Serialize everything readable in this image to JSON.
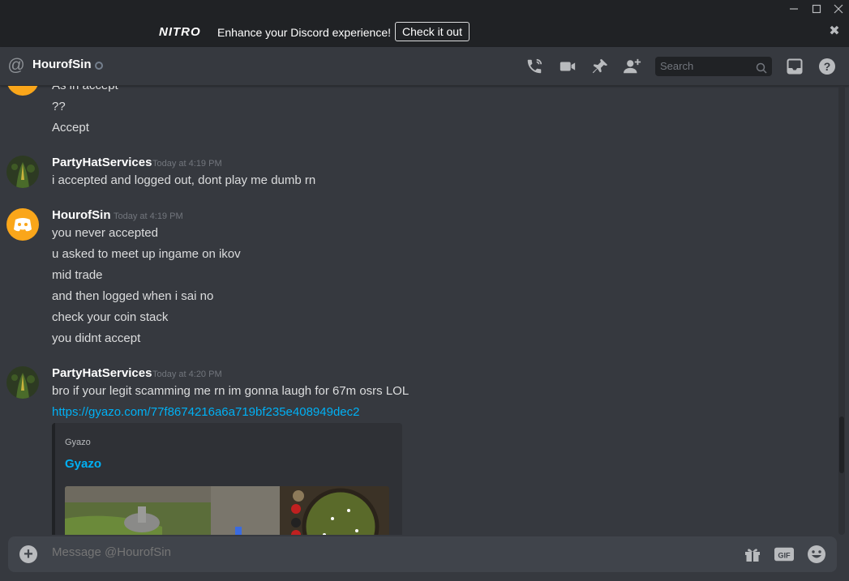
{
  "window": {
    "minimize_icon": "minimize-icon",
    "maximize_icon": "maximize-icon",
    "close_icon": "close-icon"
  },
  "nitro": {
    "logo": "NITRO",
    "tagline": "Enhance your Discord experience!",
    "cta": "Check it out",
    "dismiss": "✖"
  },
  "header": {
    "channel_name": "HourofSin",
    "search_placeholder": "Search",
    "icons": [
      "voice-call-icon",
      "video-call-icon",
      "pin-icon",
      "add-friend-icon",
      "inbox-icon",
      "help-icon"
    ]
  },
  "messages": [
    {
      "lines": [
        "As in accept",
        "??",
        "Accept"
      ]
    },
    {
      "author": "PartyHatServices",
      "time": "Today at 4:19 PM",
      "lines": [
        "i accepted and logged out, dont play me dumb rn"
      ]
    },
    {
      "author": "HourofSin",
      "time": "Today at 4:19 PM",
      "lines": [
        "you never accepted",
        "u asked to meet up ingame on ikov",
        "mid trade",
        "and then logged when i sai no",
        "check your coin stack",
        "you didnt accept"
      ]
    },
    {
      "author": "PartyHatServices",
      "time": "Today at 4:20 PM",
      "lines": [
        "bro if your legit scamming me rn im gonna laugh for 67m osrs LOL"
      ],
      "link": "https://gyazo.com/77f8674216a6a719bf235e408949dec2"
    }
  ],
  "embed": {
    "provider": "Gyazo",
    "title": "Gyazo"
  },
  "composer": {
    "placeholder": "Message @HourofSin",
    "gif_label": "GIF"
  },
  "colors": {
    "background": "#36393f",
    "titlebar": "#202225",
    "link": "#00b0f4",
    "avatar_discord": "#faa61a"
  }
}
